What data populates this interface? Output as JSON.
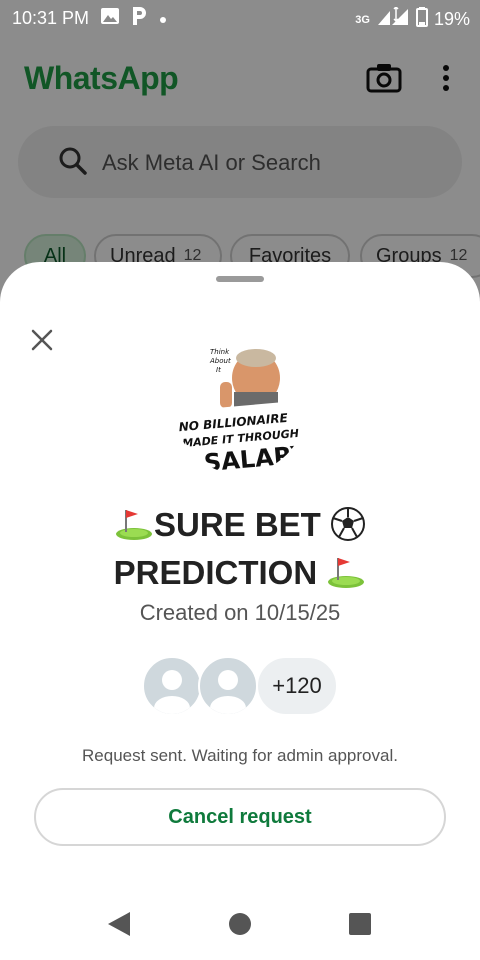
{
  "status_bar": {
    "time": "10:31 PM",
    "network": "3G",
    "battery": "19%"
  },
  "app": {
    "title": "WhatsApp",
    "brand_color": "#1f9d45",
    "search_placeholder": "Ask Meta AI or Search",
    "filters": [
      {
        "label": "All",
        "count": ""
      },
      {
        "label": "Unread",
        "count": "12"
      },
      {
        "label": "Favorites",
        "count": ""
      },
      {
        "label": "Groups",
        "count": "12"
      }
    ]
  },
  "sheet": {
    "avatar_text_top": "Think About It",
    "avatar_text_main": "NO BILLIONAIRE MADE IT THROUGH SALARY",
    "title_line1": "SURE BET",
    "title_line2": "PREDICTION",
    "created": "Created on 10/15/25",
    "member_count": "+120",
    "request_status": "Request sent. Waiting for admin approval.",
    "cancel_label": "Cancel request",
    "accent_color": "#0f7a3c"
  },
  "nav": {
    "back": "back-icon",
    "home": "home-icon",
    "recents": "recents-icon"
  }
}
